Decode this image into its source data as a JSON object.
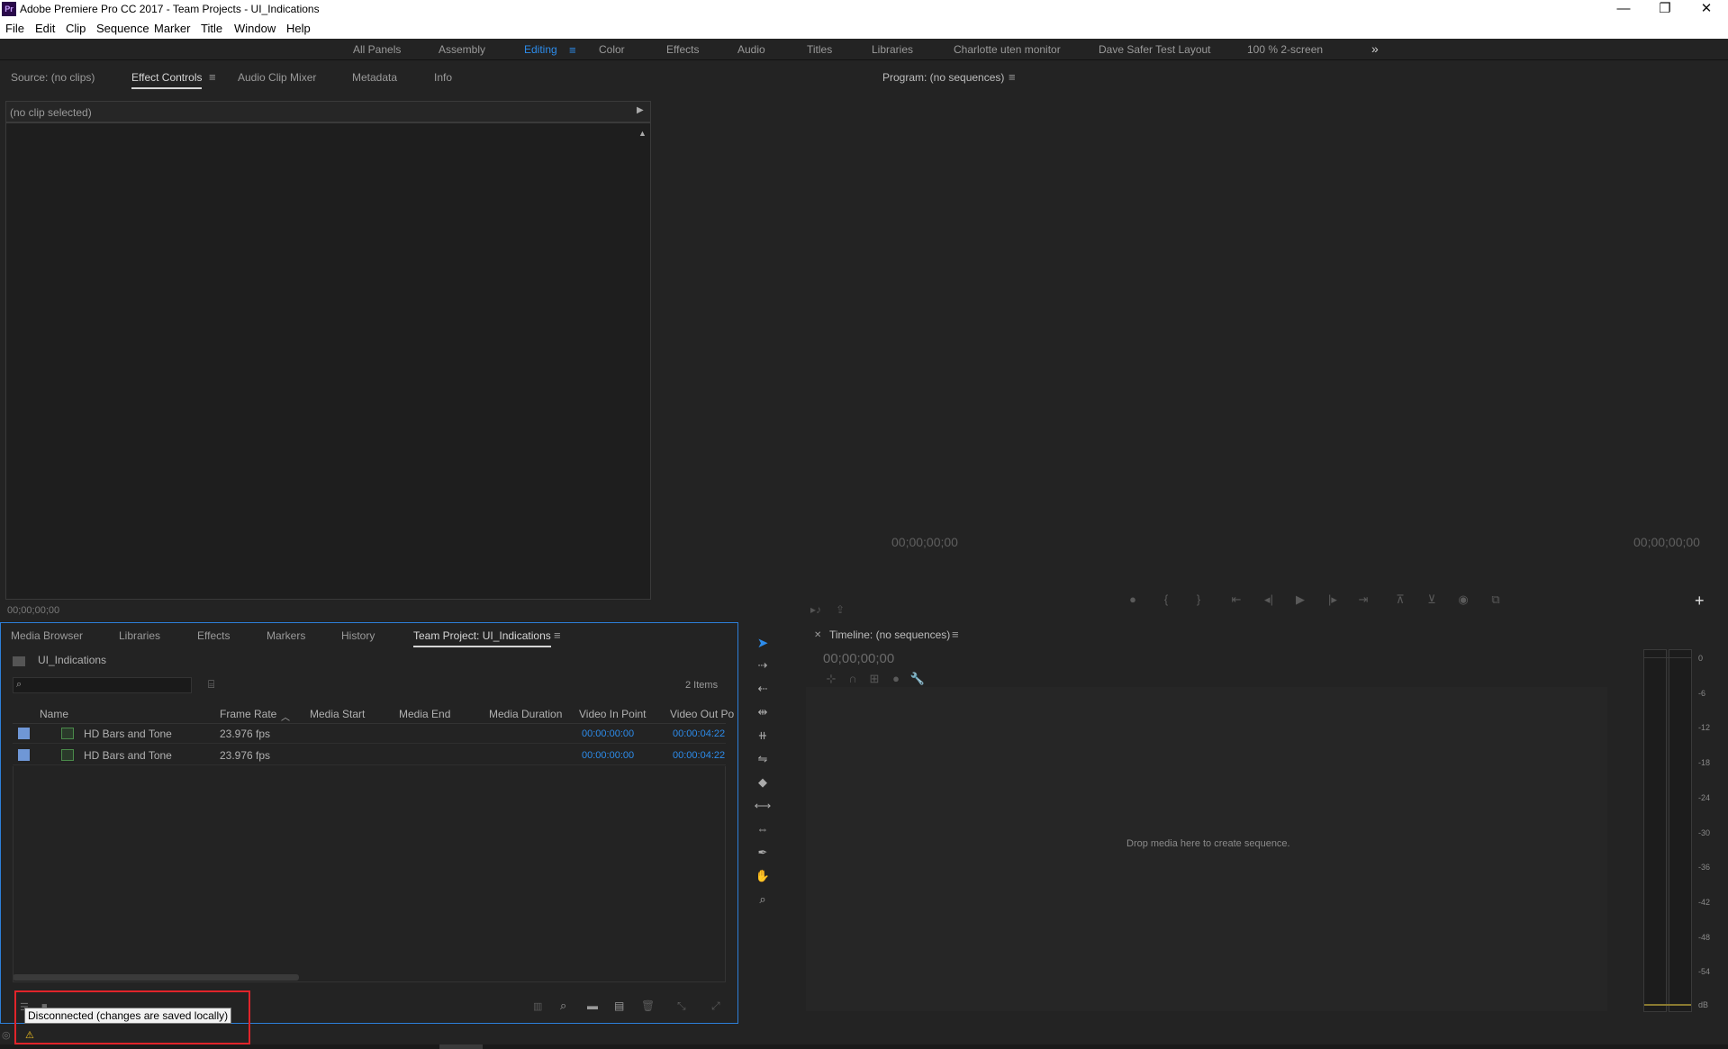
{
  "app": {
    "title": "Adobe Premiere Pro CC 2017 - Team Projects - UI_Indications",
    "logo": "Pr",
    "window_controls": {
      "minimize": "—",
      "restore": "❐",
      "close": "✕"
    }
  },
  "menu": [
    "File",
    "Edit",
    "Clip",
    "Sequence",
    "Marker",
    "Title",
    "Window",
    "Help"
  ],
  "workspaces": {
    "items": [
      "All Panels",
      "Assembly",
      "Editing",
      "Color",
      "Effects",
      "Audio",
      "Titles",
      "Libraries",
      "Charlotte uten monitor",
      "Dave Safer Test Layout",
      "100 % 2-screen"
    ],
    "active": "Editing",
    "overflow": "»"
  },
  "source_panel": {
    "tabs": [
      "Source: (no clips)",
      "Effect Controls",
      "Audio Clip Mixer",
      "Metadata",
      "Info"
    ],
    "active_tab": "Effect Controls",
    "no_clip": "(no clip selected)",
    "timecode": "00;00;00;00"
  },
  "program_panel": {
    "title": "Program: (no sequences)",
    "timecode_left": "00;00;00;00",
    "timecode_right": "00;00;00;00",
    "add_button": "+"
  },
  "project_panel": {
    "tabs": [
      "Media Browser",
      "Libraries",
      "Effects",
      "Markers",
      "History",
      "Team Project: UI_Indications"
    ],
    "active_tab": "Team Project: UI_Indications",
    "project_name": "UI_Indications",
    "search_placeholder": "",
    "item_count": "2 Items",
    "columns": [
      "Name",
      "Frame Rate",
      "Media Start",
      "Media End",
      "Media Duration",
      "Video In Point",
      "Video Out Po"
    ],
    "sort_indicator": "^",
    "rows": [
      {
        "name": "HD Bars and Tone",
        "frame_rate": "23.976 fps",
        "in": "00:00:00:00",
        "out": "00:00:04:22"
      },
      {
        "name": "HD Bars and Tone",
        "frame_rate": "23.976 fps",
        "in": "00:00:00:00",
        "out": "00:00:04:22"
      }
    ],
    "tooltip": "Disconnected (changes are saved locally)",
    "label_color": "#6f97d6"
  },
  "timeline_panel": {
    "title": "Timeline: (no sequences)",
    "timecode": "00;00;00;00",
    "drop_hint": "Drop media here to create sequence."
  },
  "audio_meter": {
    "labels": [
      "0",
      "-6",
      "-12",
      "-18",
      "-24",
      "-30",
      "-36",
      "-42",
      "-48",
      "-54",
      "dB"
    ]
  },
  "colors": {
    "accent": "#2d8ceb",
    "highlight_box": "#e0242a",
    "warning": "#f0c020"
  }
}
